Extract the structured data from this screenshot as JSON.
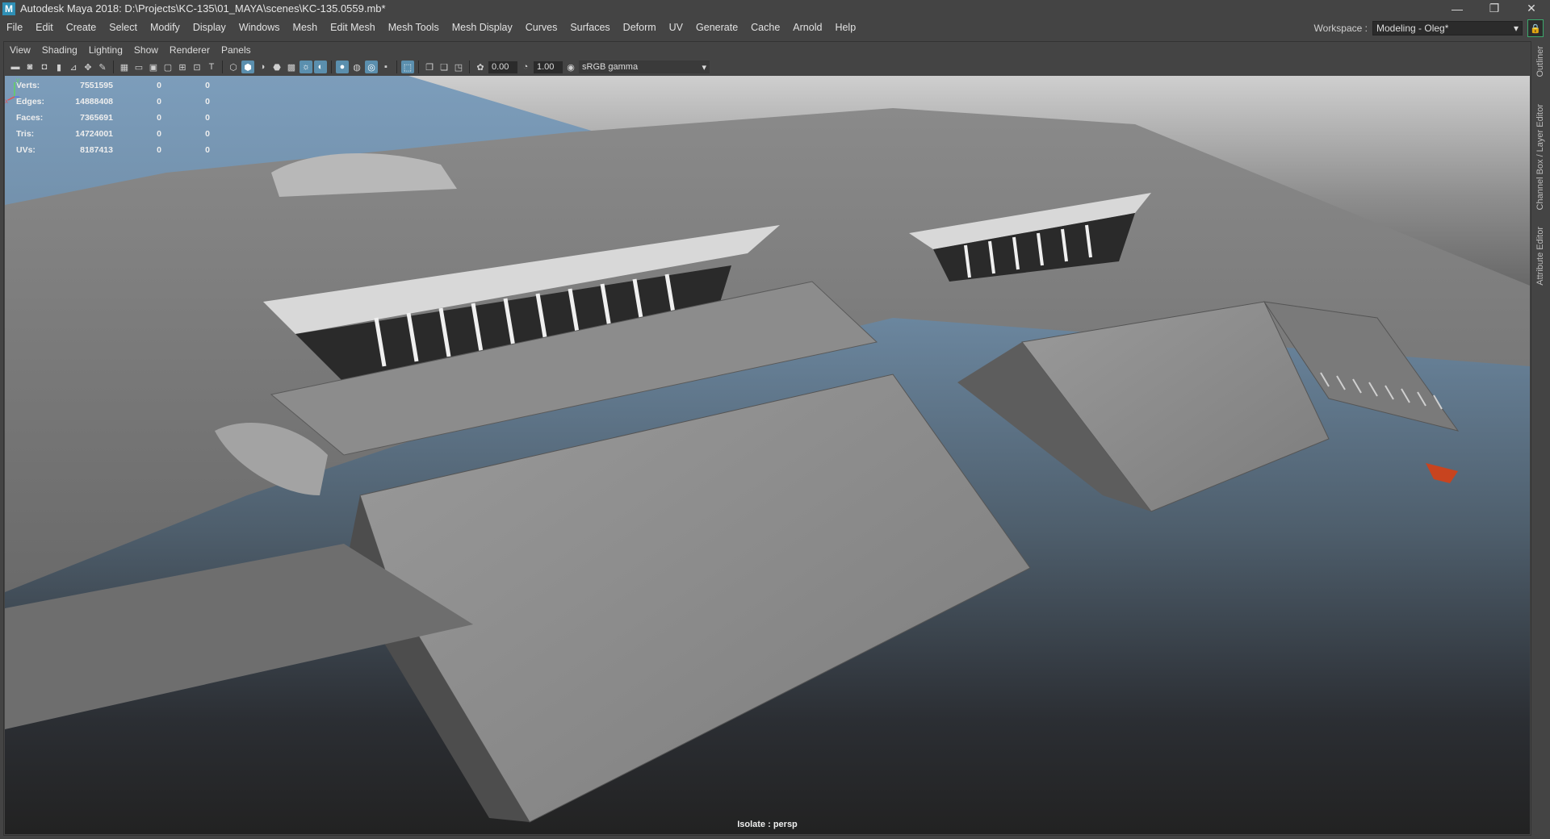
{
  "window": {
    "title": "Autodesk Maya 2018: D:\\Projects\\KC-135\\01_MAYA\\scenes\\KC-135.0559.mb*",
    "logo": "M",
    "controls": [
      "—",
      "❐",
      "✕"
    ]
  },
  "menubar": {
    "items": [
      "File",
      "Edit",
      "Create",
      "Select",
      "Modify",
      "Display",
      "Windows",
      "Mesh",
      "Edit Mesh",
      "Mesh Tools",
      "Mesh Display",
      "Curves",
      "Surfaces",
      "Deform",
      "UV",
      "Generate",
      "Cache",
      "Arnold",
      "Help"
    ]
  },
  "workspace": {
    "label": "Workspace :",
    "value": "Modeling - Oleg*"
  },
  "side_tabs": [
    "Outliner",
    "Channel Box / Layer Editor",
    "Attribute Editor"
  ],
  "panel": {
    "menu": [
      "View",
      "Shading",
      "Lighting",
      "Show",
      "Renderer",
      "Panels"
    ],
    "exposure": "0.00",
    "gamma": "1.00",
    "color_space": "sRGB gamma"
  },
  "hud": {
    "rows": [
      {
        "label": "Verts:",
        "value": "7551595",
        "sel": "0",
        "comp": "0"
      },
      {
        "label": "Edges:",
        "value": "14888408",
        "sel": "0",
        "comp": "0"
      },
      {
        "label": "Faces:",
        "value": "7365691",
        "sel": "0",
        "comp": "0"
      },
      {
        "label": "Tris:",
        "value": "14724001",
        "sel": "0",
        "comp": "0"
      },
      {
        "label": "UVs:",
        "value": "8187413",
        "sel": "0",
        "comp": "0"
      }
    ]
  },
  "camera_label": "Isolate : persp",
  "axis": {
    "y": "y",
    "x": "x"
  },
  "colors": {
    "ui_bg": "#444444",
    "accent": "#5b8fae",
    "lock_border": "#3ca86c",
    "sky_top": "#7c9dbb",
    "ground": "#222222"
  }
}
